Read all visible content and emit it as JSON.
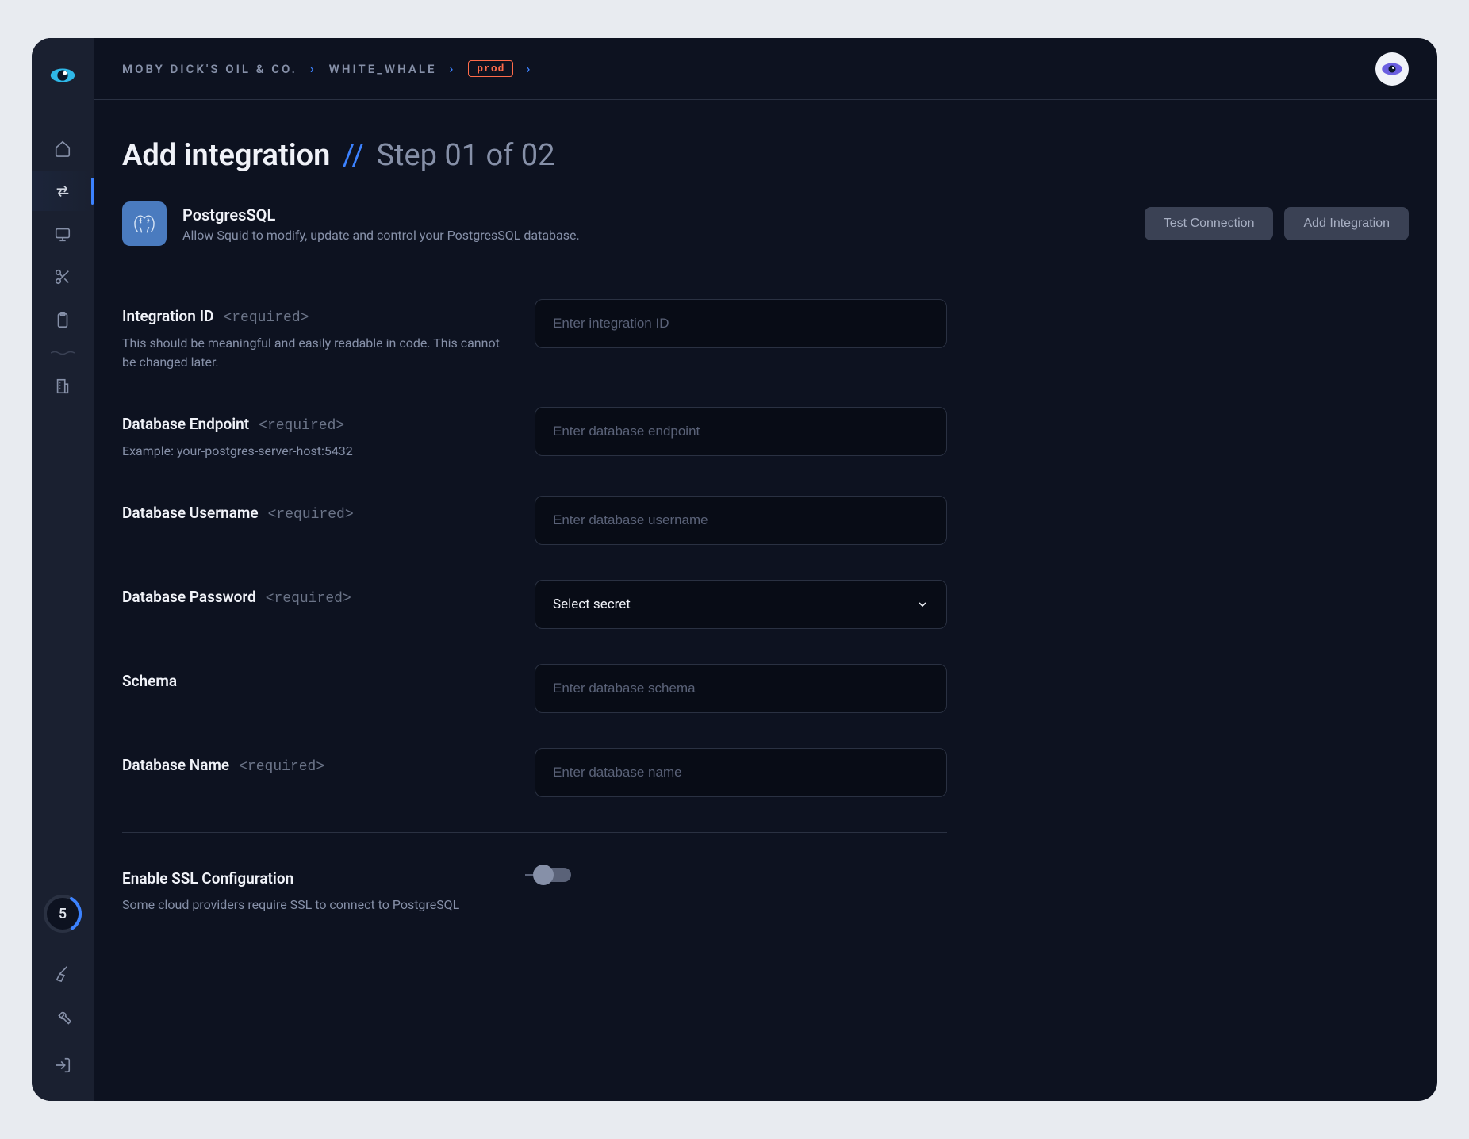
{
  "breadcrumb": {
    "org": "MOBY DICK'S OIL & CO.",
    "project": "WHITE_WHALE",
    "env": "prod"
  },
  "page": {
    "title": "Add integration",
    "step": "Step 01 of 02"
  },
  "integration": {
    "name": "PostgresSQL",
    "description": "Allow Squid to modify, update and control your PostgresSQL database."
  },
  "actions": {
    "test": "Test Connection",
    "add": "Add  Integration"
  },
  "fields": {
    "integration_id": {
      "label": "Integration ID",
      "required": "<required>",
      "help": "This should be meaningful and easily readable in code. This cannot be changed later.",
      "placeholder": "Enter integration ID"
    },
    "endpoint": {
      "label": "Database Endpoint",
      "required": "<required>",
      "help": "Example: your-postgres-server-host:5432",
      "placeholder": "Enter database endpoint"
    },
    "username": {
      "label": "Database Username",
      "required": "<required>",
      "placeholder": "Enter database username"
    },
    "password": {
      "label": "Database Password",
      "required": "<required>",
      "placeholder": "Select secret"
    },
    "schema": {
      "label": "Schema",
      "placeholder": "Enter database schema"
    },
    "dbname": {
      "label": "Database Name",
      "required": "<required>",
      "placeholder": "Enter database name"
    }
  },
  "ssl": {
    "label": "Enable SSL Configuration",
    "help": "Some cloud providers require SSL to connect to PostgreSQL"
  },
  "sidebar": {
    "badge": "5"
  }
}
